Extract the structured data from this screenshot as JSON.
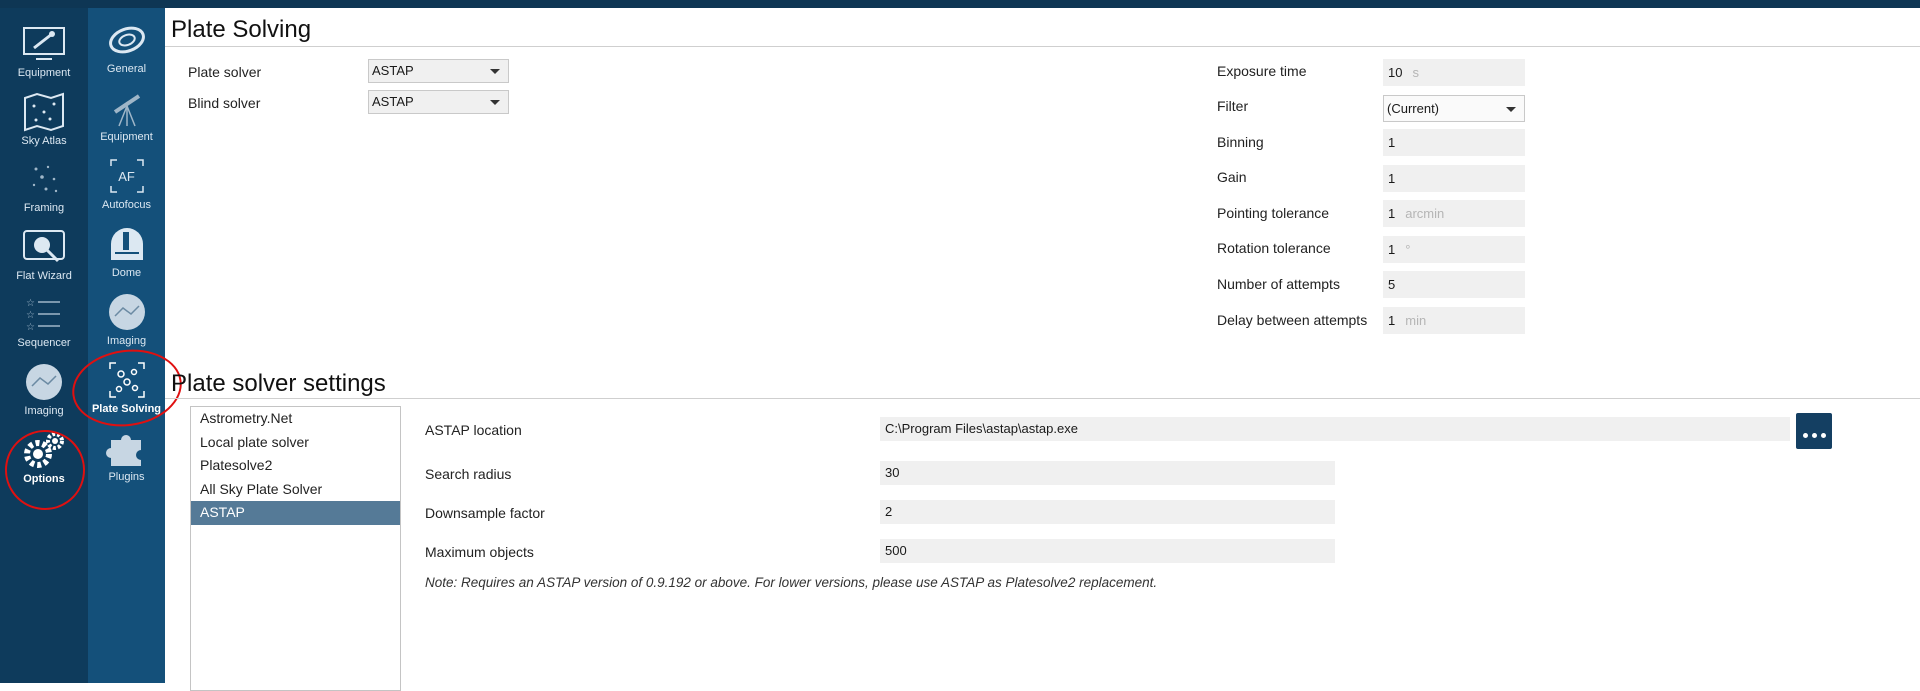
{
  "nav_primary": [
    {
      "label": "Equipment",
      "icon": "telescope-screen-icon"
    },
    {
      "label": "Sky Atlas",
      "icon": "sky-map-icon"
    },
    {
      "label": "Framing",
      "icon": "stars-icon"
    },
    {
      "label": "Flat Wizard",
      "icon": "flat-wizard-icon"
    },
    {
      "label": "Sequencer",
      "icon": "sequencer-icon"
    },
    {
      "label": "Imaging",
      "icon": "imaging-icon"
    },
    {
      "label": "Options",
      "icon": "gears-icon"
    }
  ],
  "nav_secondary": [
    {
      "label": "General",
      "icon": "galaxy-icon"
    },
    {
      "label": "Equipment",
      "icon": "telescope-icon"
    },
    {
      "label": "Autofocus",
      "icon": "autofocus-icon",
      "glyph": "AF"
    },
    {
      "label": "Dome",
      "icon": "dome-icon"
    },
    {
      "label": "Imaging",
      "icon": "imaging-icon"
    },
    {
      "label": "Plate Solving",
      "icon": "plate-solving-icon"
    },
    {
      "label": "Plugins",
      "icon": "puzzle-icon"
    }
  ],
  "plate_solving": {
    "title": "Plate Solving",
    "plate_solver_label": "Plate solver",
    "plate_solver_value": "ASTAP",
    "blind_solver_label": "Blind solver",
    "blind_solver_value": "ASTAP",
    "exposure_time": {
      "label": "Exposure time",
      "value": "10",
      "unit": "s"
    },
    "filter": {
      "label": "Filter",
      "value": "(Current)"
    },
    "binning": {
      "label": "Binning",
      "value": "1"
    },
    "gain": {
      "label": "Gain",
      "value": "1"
    },
    "pointing_tolerance": {
      "label": "Pointing tolerance",
      "value": "1",
      "unit": "arcmin"
    },
    "rotation_tolerance": {
      "label": "Rotation tolerance",
      "value": "1",
      "unit": "°"
    },
    "attempts": {
      "label": "Number of attempts",
      "value": "5"
    },
    "delay": {
      "label": "Delay between attempts",
      "value": "1",
      "unit": "min"
    }
  },
  "solver_settings": {
    "title": "Plate solver settings",
    "solvers": [
      "Astrometry.Net",
      "Local plate solver",
      "Platesolve2",
      "All Sky Plate Solver",
      "ASTAP"
    ],
    "astap_location": {
      "label": "ASTAP location",
      "value": "C:\\Program Files\\astap\\astap.exe"
    },
    "search_radius": {
      "label": "Search radius",
      "value": "30"
    },
    "downsample_factor": {
      "label": "Downsample factor",
      "value": "2"
    },
    "maximum_objects": {
      "label": "Maximum objects",
      "value": "500"
    },
    "note": "Note: Requires an ASTAP version of 0.9.192 or above. For lower versions, please use ASTAP as Platesolve2 replacement."
  },
  "colors": {
    "nav_primary": "#0e3b5c",
    "nav_secondary": "#14507a",
    "selected": "#557a97",
    "annotation": "#e01010"
  }
}
